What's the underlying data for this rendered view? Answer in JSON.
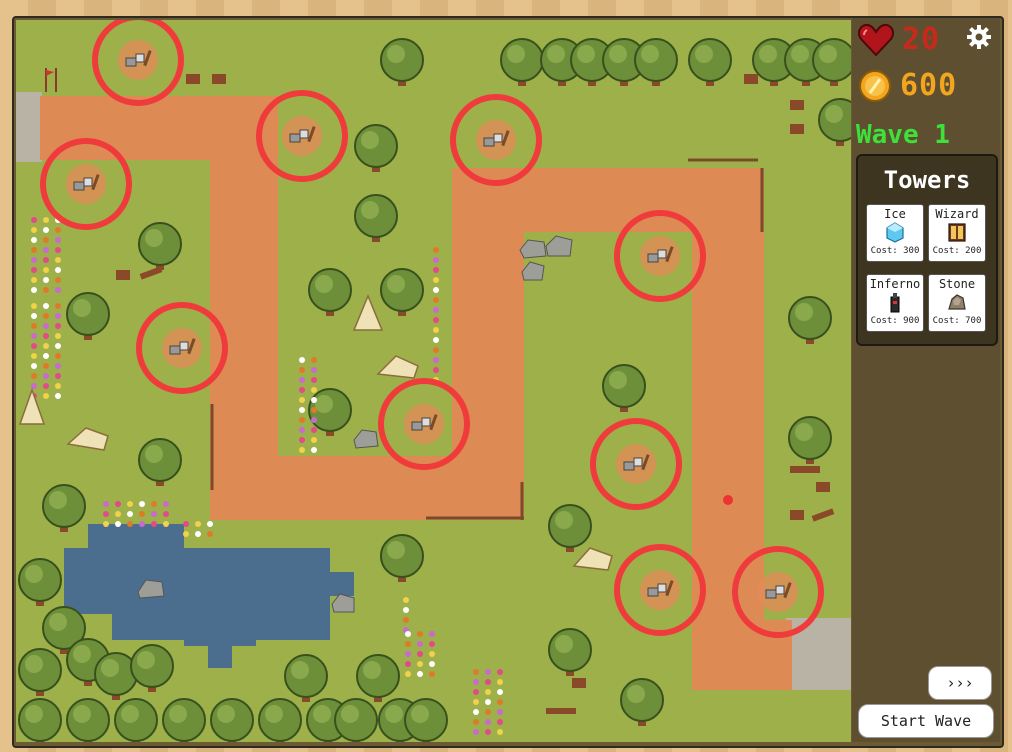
{
  "hud": {
    "lives": "20",
    "gold": "600",
    "wave_label": "Wave 1",
    "settings_icon": "gear-icon",
    "lives_icon": "heart-icon",
    "gold_icon": "coin-icon"
  },
  "towers_panel": {
    "title": "Towers",
    "towers": [
      {
        "name": "Ice",
        "cost": "Cost: 300",
        "icon": "ice-tower-icon"
      },
      {
        "name": "Wizard",
        "cost": "Cost: 200",
        "icon": "wizard-tower-icon"
      },
      {
        "name": "Inferno",
        "cost": "Cost: 900",
        "icon": "inferno-tower-icon"
      },
      {
        "name": "Stone",
        "cost": "Cost: 700",
        "icon": "stone-tower-icon"
      }
    ]
  },
  "controls": {
    "speed_label": "›››",
    "start_wave_label": "Start Wave"
  },
  "colors": {
    "grass": "#9db04a",
    "path": "#dd8a55",
    "water": "#4b6e8e",
    "highlight_ring": "#ef3b3b",
    "lives": "#c8291b",
    "gold": "#f2a51e",
    "wave": "#3ee13a"
  }
}
